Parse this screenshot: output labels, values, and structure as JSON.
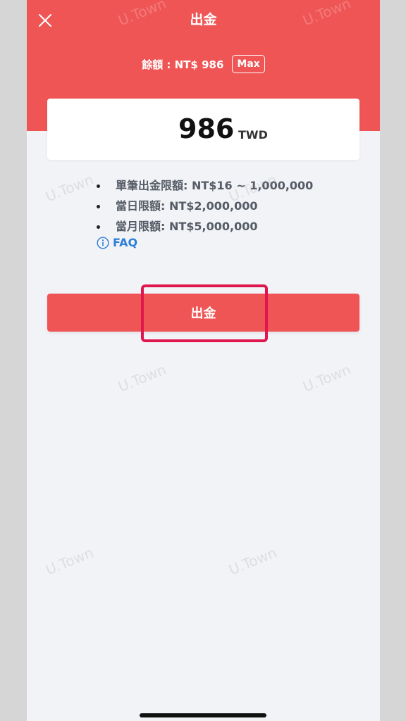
{
  "header": {
    "title": "出金",
    "close_icon": "close-icon",
    "balance_label": "餘額 : NT$ 986",
    "max_label": "Max"
  },
  "amount": {
    "value": "986",
    "currency": "TWD"
  },
  "limits": [
    "單筆出金限額: NT$16 ~ 1,000,000",
    "當日限額: NT$2,000,000",
    "當月限額: NT$5,000,000"
  ],
  "faq": {
    "label": "FAQ",
    "icon": "info-icon"
  },
  "withdraw_button": {
    "label": "出金"
  },
  "watermark": "U.Town",
  "colors": {
    "accent": "#ef5555",
    "link": "#2d7fd8",
    "highlight": "#e0174e",
    "background": "#f2f3f7"
  }
}
